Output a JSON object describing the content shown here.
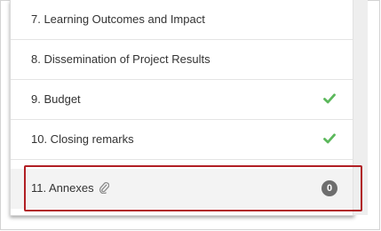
{
  "sections": [
    {
      "label": "7. Learning Outcomes and Impact",
      "completed": false
    },
    {
      "label": "8. Dissemination of Project Results",
      "completed": false
    },
    {
      "label": "9. Budget",
      "completed": true
    },
    {
      "label": "10. Closing remarks",
      "completed": true
    },
    {
      "label": "11. Annexes",
      "completed": false,
      "attachment_icon": "paperclip-icon",
      "count": "0"
    }
  ],
  "colors": {
    "check": "#5cb85c",
    "badge": "#6e6e6e",
    "highlight": "#b11f24"
  }
}
